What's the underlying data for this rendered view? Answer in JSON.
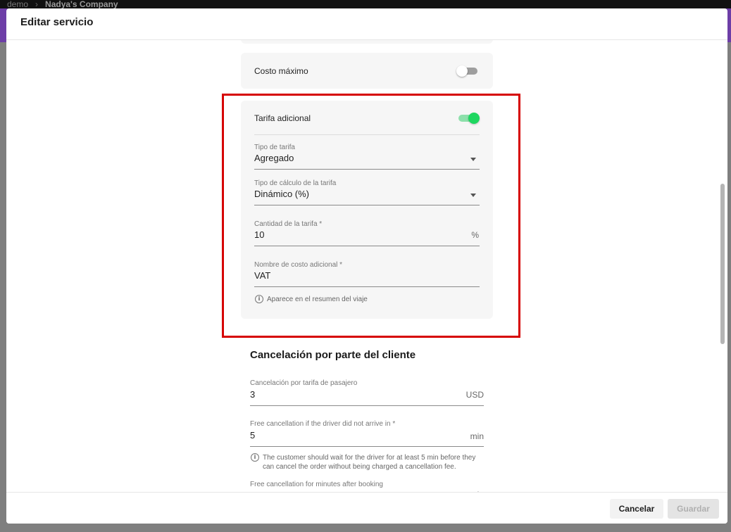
{
  "backdrop": {
    "breadcrumb_root": "demo",
    "breadcrumb_company": "Nadya's Company"
  },
  "modal": {
    "title": "Editar servicio"
  },
  "costo_maximo": {
    "label": "Costo máximo",
    "enabled": false
  },
  "tarifa_adicional": {
    "label": "Tarifa adicional",
    "enabled": true,
    "tipo_tarifa": {
      "label": "Tipo de tarifa",
      "value": "Agregado"
    },
    "tipo_calculo": {
      "label": "Tipo de cálculo de la tarifa",
      "value": "Dinámico (%)"
    },
    "cantidad": {
      "label": "Cantidad de la tarifa *",
      "value": "10",
      "suffix": "%"
    },
    "nombre_costo": {
      "label": "Nombre de costo adicional *",
      "value": "VAT",
      "hint": "Aparece en el resumen del viaje"
    }
  },
  "cancelacion": {
    "title": "Cancelación por parte del cliente",
    "tarifa_pasajero": {
      "label": "Cancelación por tarifa de pasajero",
      "value": "3",
      "suffix": "USD"
    },
    "free_driver_not_arrive": {
      "label": "Free cancellation if the driver did not arrive in *",
      "value": "5",
      "suffix": "min",
      "hint_line1": "The customer should wait for the driver for at least 5 min before they",
      "hint_line2": "can cancel the order without being charged a cancellation fee."
    },
    "free_after_booking": {
      "label": "Free cancellation for minutes after booking",
      "suffix": "min"
    }
  },
  "footer": {
    "cancel_label": "Cancelar",
    "save_label": "Guardar"
  },
  "colors": {
    "toggle_on": "#1ed760",
    "highlight": "#d60000",
    "backdrop_purple": "#6d3ea7"
  }
}
